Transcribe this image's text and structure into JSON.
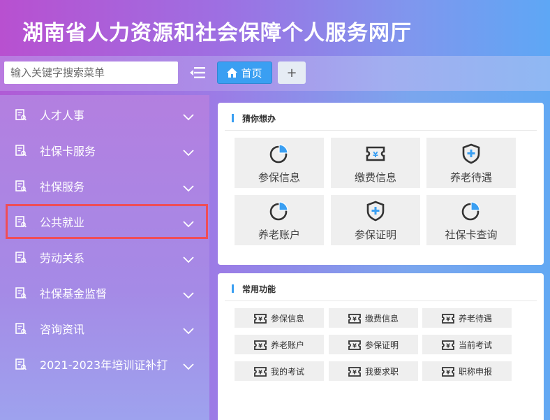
{
  "header": {
    "title": "湖南省人力资源和社会保障个人服务网厅"
  },
  "toolbar": {
    "search_placeholder": "输入关键字搜索菜单",
    "home_tab": "首页",
    "add_tab": "+"
  },
  "sidebar": {
    "items": [
      {
        "label": "人才人事"
      },
      {
        "label": "社保卡服务"
      },
      {
        "label": "社保服务"
      },
      {
        "label": "公共就业"
      },
      {
        "label": "劳动关系"
      },
      {
        "label": "社保基金监督"
      },
      {
        "label": "咨询资讯"
      },
      {
        "label": "2021-2023年培训证补打"
      }
    ]
  },
  "guess": {
    "title": "猜你想办",
    "tiles": [
      {
        "label": "参保信息",
        "icon": "pie-chart-icon"
      },
      {
        "label": "缴费信息",
        "icon": "yuan-ticket-icon"
      },
      {
        "label": "养老待遇",
        "icon": "shield-plus-icon"
      },
      {
        "label": "养老账户",
        "icon": "pie-chart-icon"
      },
      {
        "label": "参保证明",
        "icon": "shield-plus-icon"
      },
      {
        "label": "社保卡查询",
        "icon": "pie-chart-icon"
      }
    ]
  },
  "common": {
    "title": "常用功能",
    "chips": [
      {
        "label": "参保信息"
      },
      {
        "label": "缴费信息"
      },
      {
        "label": "养老待遇"
      },
      {
        "label": "养老账户"
      },
      {
        "label": "参保证明"
      },
      {
        "label": "当前考试"
      },
      {
        "label": "我的考试"
      },
      {
        "label": "我要求职"
      },
      {
        "label": "职称申报"
      }
    ]
  },
  "colors": {
    "accent": "#3a9ff2",
    "highlight_border": "#ef4d57"
  }
}
